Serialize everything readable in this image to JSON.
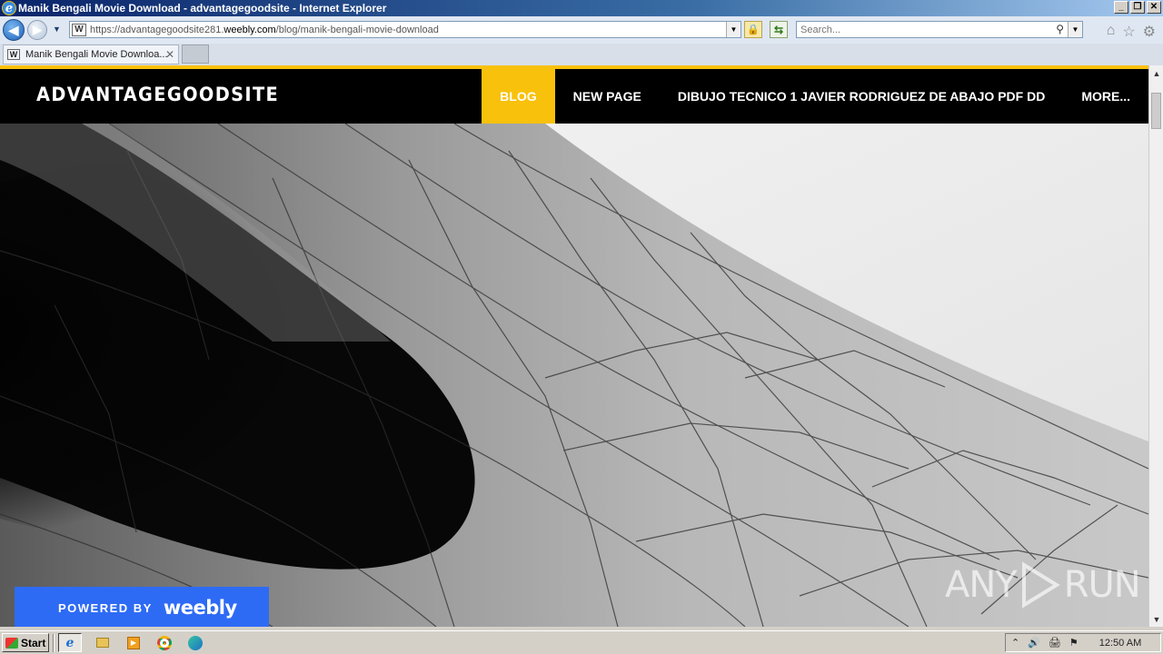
{
  "window": {
    "title": "Manik Bengali Movie Download - advantagegoodsite - Internet Explorer",
    "minimize_label": "_",
    "restore_label": "❐",
    "close_label": "✕"
  },
  "address_bar": {
    "url_prefix": "https://advantagegoodsite281.",
    "url_domain": "weebly.com",
    "url_path": "/blog/manik-bengali-movie-download"
  },
  "search": {
    "placeholder": "Search..."
  },
  "tabs": [
    {
      "label": "Manik Bengali Movie Downloa...",
      "active": true
    }
  ],
  "site": {
    "title": "ADVANTAGEGOODSITE",
    "nav": [
      {
        "label": "BLOG",
        "active": true
      },
      {
        "label": "NEW PAGE",
        "active": false
      },
      {
        "label": "DIBUJO TECNICO 1 JAVIER RODRIGUEZ DE ABAJO PDF DD",
        "active": false
      },
      {
        "label": "MORE...",
        "active": false
      }
    ],
    "accent_color": "#f8c10b"
  },
  "weebly_badge": {
    "powered_by": "POWERED BY",
    "brand": "weebly",
    "color": "#2e6bf5"
  },
  "watermark": {
    "left": "ANY",
    "right": "RUN"
  },
  "taskbar": {
    "start_label": "Start",
    "apps": [
      "ie-icon",
      "explorer-folder-icon",
      "media-player-icon",
      "chrome-icon",
      "edge-icon"
    ],
    "clock": "12:50 AM"
  }
}
